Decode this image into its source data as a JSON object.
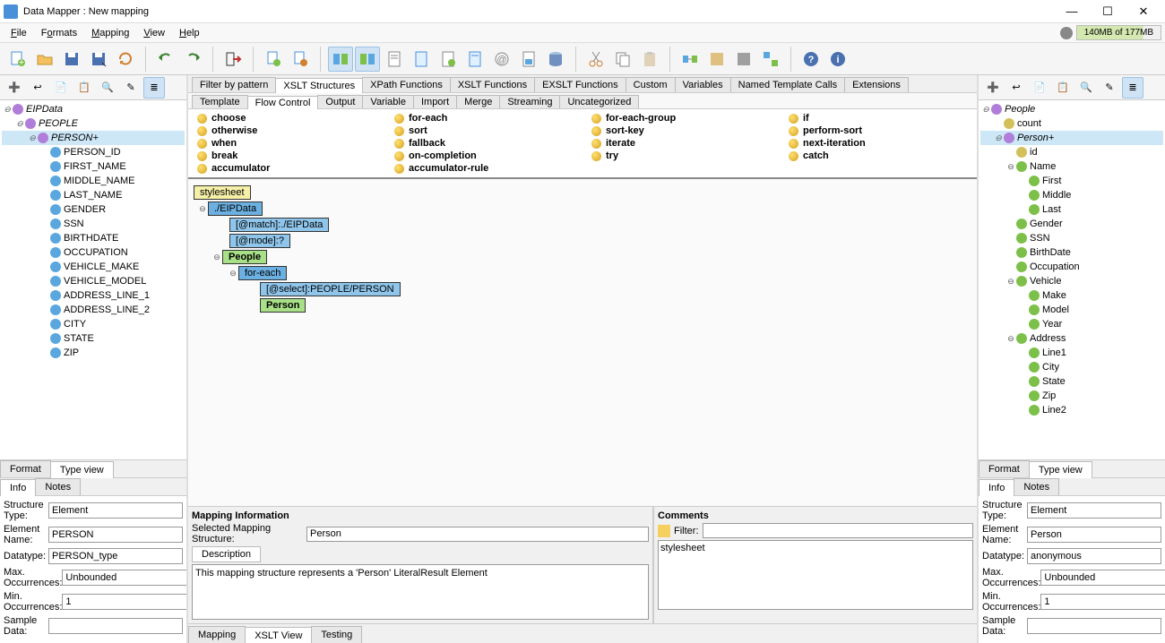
{
  "title": "Data Mapper : New mapping",
  "memory": "140MB of 177MB",
  "menus": {
    "file": "File",
    "formats": "Formats",
    "mapping": "Mapping",
    "view": "View",
    "help": "Help"
  },
  "centerTabs": {
    "filter": "Filter by pattern",
    "xsltStruct": "XSLT Structures",
    "xpath": "XPath Functions",
    "xsltFunc": "XSLT Functions",
    "exslt": "EXSLT Functions",
    "custom": "Custom",
    "vars": "Variables",
    "named": "Named Template Calls",
    "ext": "Extensions"
  },
  "subTabs": {
    "template": "Template",
    "flow": "Flow Control",
    "output": "Output",
    "variable": "Variable",
    "import": "Import",
    "merge": "Merge",
    "streaming": "Streaming",
    "uncat": "Uncategorized"
  },
  "flowItems": {
    "choose": "choose",
    "foreach": "for-each",
    "foreachgroup": "for-each-group",
    "if": "if",
    "otherwise": "otherwise",
    "sort": "sort",
    "sortkey": "sort-key",
    "performsort": "perform-sort",
    "when": "when",
    "fallback": "fallback",
    "iterate": "iterate",
    "nextiter": "next-iteration",
    "break": "break",
    "oncomp": "on-completion",
    "try": "try",
    "catch": "catch",
    "accum": "accumulator",
    "accumrule": "accumulator-rule"
  },
  "leftTree": {
    "root": "EIPData",
    "people": "PEOPLE",
    "person": "PERSON+",
    "fields": {
      "f0": "PERSON_ID",
      "f1": "FIRST_NAME",
      "f2": "MIDDLE_NAME",
      "f3": "LAST_NAME",
      "f4": "GENDER",
      "f5": "SSN",
      "f6": "BIRTHDATE",
      "f7": "OCCUPATION",
      "f8": "VEHICLE_MAKE",
      "f9": "VEHICLE_MODEL",
      "f10": "ADDRESS_LINE_1",
      "f11": "ADDRESS_LINE_2",
      "f12": "CITY",
      "f13": "STATE",
      "f14": "ZIP"
    }
  },
  "rightTree": {
    "root": "People",
    "count": "count",
    "person": "Person+",
    "id": "id",
    "name": "Name",
    "nameFields": {
      "first": "First",
      "middle": "Middle",
      "last": "Last"
    },
    "gender": "Gender",
    "ssn": "SSN",
    "birth": "BirthDate",
    "occ": "Occupation",
    "vehicle": "Vehicle",
    "vehFields": {
      "make": "Make",
      "model": "Model",
      "year": "Year"
    },
    "address": "Address",
    "addrFields": {
      "line1": "Line1",
      "city": "City",
      "state": "State",
      "zip": "Zip",
      "line2": "Line2"
    }
  },
  "canvas": {
    "stylesheet": "stylesheet",
    "eip": "./EIPData",
    "match": "[@match]:./EIPData",
    "mode": "[@mode]:?",
    "people": "People",
    "foreach": "for-each",
    "select": "[@select]:PEOPLE/PERSON",
    "person": "Person"
  },
  "mappingInfo": {
    "title": "Mapping Information",
    "selLabel": "Selected Mapping Structure:",
    "selValue": "Person",
    "descTab": "Description",
    "desc": "This mapping structure represents a 'Person' LiteralResult Element"
  },
  "comments": {
    "title": "Comments",
    "filterLabel": "Filter:",
    "item": "stylesheet"
  },
  "bottomCenterTabs": {
    "mapping": "Mapping",
    "xslt": "XSLT View",
    "testing": "Testing"
  },
  "sideTabs": {
    "format": "Format",
    "typeview": "Type view",
    "info": "Info",
    "notes": "Notes"
  },
  "leftForm": {
    "structType": {
      "label": "Structure Type:",
      "value": "Element"
    },
    "elemName": {
      "label": "Element Name:",
      "value": "PERSON"
    },
    "datatype": {
      "label": "Datatype:",
      "value": "PERSON_type"
    },
    "maxOcc": {
      "label": "Max. Occurrences:",
      "value": "Unbounded"
    },
    "minOcc": {
      "label": "Min. Occurrences:",
      "value": "1"
    },
    "sample": {
      "label": "Sample Data:",
      "value": ""
    }
  },
  "rightForm": {
    "structType": {
      "label": "Structure Type:",
      "value": "Element"
    },
    "elemName": {
      "label": "Element Name:",
      "value": "Person"
    },
    "datatype": {
      "label": "Datatype:",
      "value": "anonymous"
    },
    "maxOcc": {
      "label": "Max. Occurrences:",
      "value": "Unbounded"
    },
    "minOcc": {
      "label": "Min. Occurrences:",
      "value": "1"
    },
    "sample": {
      "label": "Sample Data:",
      "value": ""
    }
  }
}
